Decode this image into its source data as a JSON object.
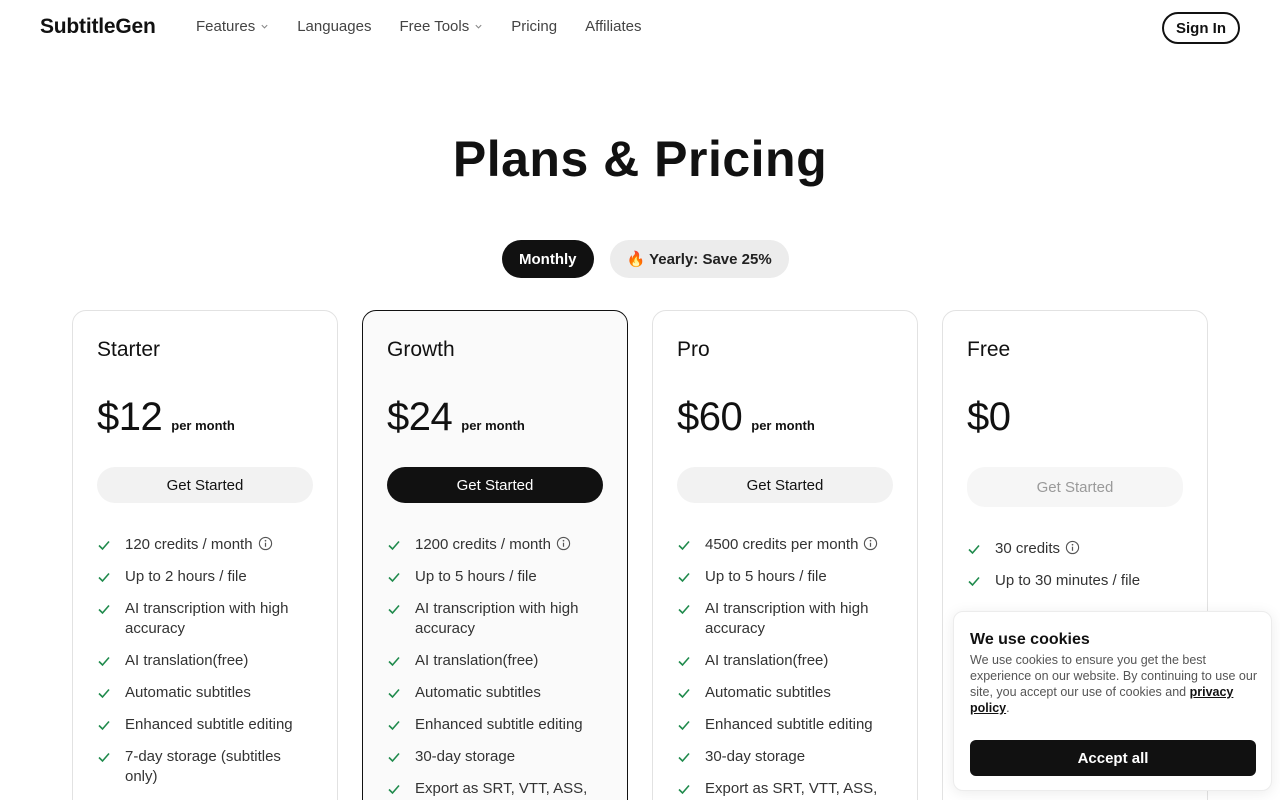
{
  "header": {
    "logo": "SubtitleGen",
    "nav": [
      {
        "label": "Features",
        "has_dropdown": true
      },
      {
        "label": "Languages",
        "has_dropdown": false
      },
      {
        "label": "Free Tools",
        "has_dropdown": true
      },
      {
        "label": "Pricing",
        "has_dropdown": false
      },
      {
        "label": "Affiliates",
        "has_dropdown": false
      }
    ],
    "sign_in": "Sign In"
  },
  "page_title": "Plans & Pricing",
  "billing_toggle": {
    "monthly": "Monthly",
    "yearly": "🔥 Yearly: Save 25%",
    "selected": "Monthly"
  },
  "plans": [
    {
      "name": "Starter",
      "price": "$12",
      "period": "per month",
      "cta": "Get Started",
      "features": [
        {
          "text": "120 credits / month",
          "info": true
        },
        {
          "text": "Up to 2 hours / file"
        },
        {
          "text": "AI transcription with high accuracy"
        },
        {
          "text": "AI translation(free)"
        },
        {
          "text": "Automatic subtitles"
        },
        {
          "text": "Enhanced subtitle editing"
        },
        {
          "text": "7-day storage (subtitles only)"
        }
      ]
    },
    {
      "name": "Growth",
      "price": "$24",
      "period": "per month",
      "cta": "Get Started",
      "features": [
        {
          "text": "1200 credits / month",
          "info": true
        },
        {
          "text": "Up to 5 hours / file"
        },
        {
          "text": "AI transcription with high accuracy"
        },
        {
          "text": "AI translation(free)"
        },
        {
          "text": "Automatic subtitles"
        },
        {
          "text": "Enhanced subtitle editing"
        },
        {
          "text": "30-day storage"
        },
        {
          "text": "Export as SRT, VTT, ASS,"
        }
      ]
    },
    {
      "name": "Pro",
      "price": "$60",
      "period": "per month",
      "cta": "Get Started",
      "features": [
        {
          "text": "4500 credits per month",
          "info": true
        },
        {
          "text": "Up to 5 hours / file"
        },
        {
          "text": "AI transcription with high accuracy"
        },
        {
          "text": "AI translation(free)"
        },
        {
          "text": "Automatic subtitles"
        },
        {
          "text": "Enhanced subtitle editing"
        },
        {
          "text": "30-day storage"
        },
        {
          "text": "Export as SRT, VTT, ASS,"
        }
      ]
    },
    {
      "name": "Free",
      "price": "$0",
      "cta": "Get Started",
      "features": [
        {
          "text": "30 credits",
          "info": true
        },
        {
          "text": "Up to 30 minutes / file"
        }
      ]
    }
  ],
  "cookie_banner": {
    "title": "We use cookies",
    "text": "We use cookies to ensure you get the best experience on our website. By continuing to use our site, you accept our use of cookies and",
    "link": "privacy policy",
    "text_end": ".",
    "accept": "Accept all"
  },
  "colors": {
    "primary": "#111111",
    "check": "#1f8a4c",
    "muted_button": "#f2f2f2"
  }
}
